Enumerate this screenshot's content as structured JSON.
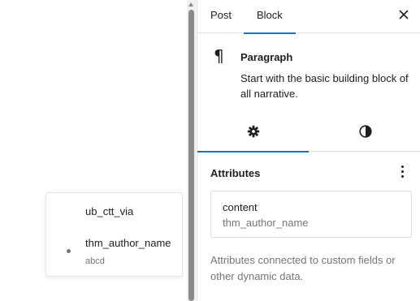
{
  "popover": {
    "items": [
      {
        "label": "ub_ctt_via"
      },
      {
        "label": "thm_author_name",
        "sub": "abcd"
      }
    ]
  },
  "sidebar": {
    "tabs": [
      {
        "label": "Post"
      },
      {
        "label": "Block"
      }
    ],
    "block": {
      "icon": "paragraph-icon",
      "title": "Paragraph",
      "description": "Start with the basic building block of all narrative."
    },
    "subtabs": [
      {
        "icon": "gear-icon"
      },
      {
        "icon": "half-circle-styles-icon"
      }
    ],
    "attributes": {
      "title": "Attributes",
      "item": {
        "name": "content",
        "value": "thm_author_name"
      },
      "help": "Attributes connected to custom fields or other dynamic data."
    }
  },
  "colors": {
    "accent": "#2271b1",
    "muted": "#757575",
    "border": "#e0e0e0"
  }
}
